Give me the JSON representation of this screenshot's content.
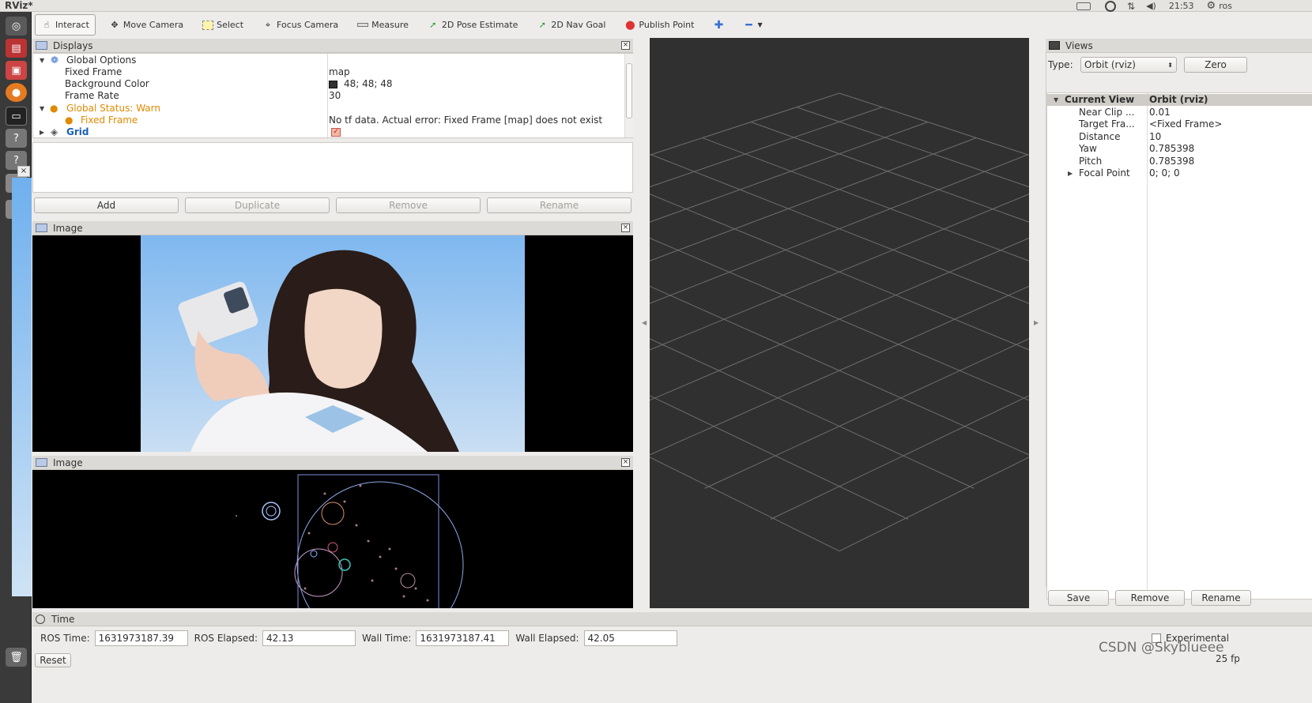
{
  "window": {
    "title": "RViz*"
  },
  "tray": {
    "time": "21:53",
    "user": "ros"
  },
  "toolbar": {
    "tools": [
      {
        "label": "Interact",
        "icon": "hand-icon",
        "active": true
      },
      {
        "label": "Move Camera",
        "icon": "move-camera-icon"
      },
      {
        "label": "Select",
        "icon": "select-icon"
      },
      {
        "label": "Focus Camera",
        "icon": "focus-camera-icon"
      },
      {
        "label": "Measure",
        "icon": "ruler-icon"
      },
      {
        "label": "2D Pose Estimate",
        "icon": "pose-arrow-icon"
      },
      {
        "label": "2D Nav Goal",
        "icon": "nav-arrow-icon"
      },
      {
        "label": "Publish Point",
        "icon": "map-pin-icon"
      }
    ]
  },
  "displays": {
    "title": "Displays",
    "global_options": {
      "label": "Global Options",
      "fixed_frame_key": "Fixed Frame",
      "fixed_frame_val": "map",
      "bg_key": "Background Color",
      "bg_val": "48; 48; 48",
      "rate_key": "Frame Rate",
      "rate_val": "30"
    },
    "status": {
      "label": "Global Status: Warn",
      "fixed_frame_key": "Fixed Frame",
      "fixed_frame_val": "No tf data.  Actual error: Fixed Frame [map] does not exist"
    },
    "grid": {
      "label": "Grid"
    },
    "buttons": {
      "add": "Add",
      "duplicate": "Duplicate",
      "remove": "Remove",
      "rename": "Rename"
    }
  },
  "image_panels": {
    "title1": "Image",
    "title2": "Image"
  },
  "views": {
    "title": "Views",
    "type_label": "Type:",
    "type_value": "Orbit (rviz)",
    "zero": "Zero",
    "current_view_key": "Current View",
    "current_view_val": "Orbit (rviz)",
    "rows": [
      {
        "key": "Near Clip ...",
        "val": "0.01"
      },
      {
        "key": "Target Fra...",
        "val": "<Fixed Frame>"
      },
      {
        "key": "Distance",
        "val": "10"
      },
      {
        "key": "Yaw",
        "val": "0.785398"
      },
      {
        "key": "Pitch",
        "val": "0.785398"
      },
      {
        "key": "Focal Point",
        "val": "0; 0; 0"
      }
    ],
    "buttons": {
      "save": "Save",
      "remove": "Remove",
      "rename": "Rename"
    }
  },
  "time": {
    "title": "Time",
    "ros_time_label": "ROS Time:",
    "ros_time": "1631973187.39",
    "ros_elapsed_label": "ROS Elapsed:",
    "ros_elapsed": "42.13",
    "wall_time_label": "Wall Time:",
    "wall_time": "1631973187.41",
    "wall_elapsed_label": "Wall Elapsed:",
    "wall_elapsed": "42.05",
    "experimental": "Experimental",
    "reset": "Reset",
    "fps": "25 fp"
  },
  "watermark": "CSDN @Skyblueee",
  "colors": {
    "render_bg": "#303030",
    "warn": "#e08a00",
    "link": "#1a5fb4"
  }
}
